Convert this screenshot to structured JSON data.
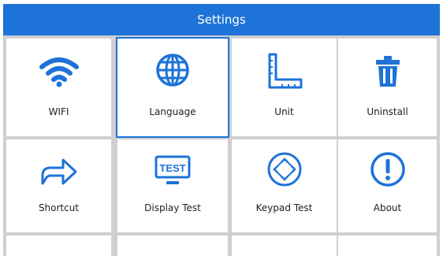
{
  "header": {
    "title": "Settings"
  },
  "colors": {
    "accent": "#1e73d8",
    "icon": "#1e73d8",
    "divider": "#cfcfcf"
  },
  "tiles": [
    {
      "label": "WIFI",
      "icon": "wifi-icon",
      "selected": false
    },
    {
      "label": "Language",
      "icon": "globe-icon",
      "selected": true
    },
    {
      "label": "Unit",
      "icon": "ruler-icon",
      "selected": false
    },
    {
      "label": "Uninstall",
      "icon": "trash-icon",
      "selected": false
    },
    {
      "label": "Shortcut",
      "icon": "share-arrow-icon",
      "selected": false
    },
    {
      "label": "Display Test",
      "icon": "display-test-icon",
      "selected": false,
      "icon_text": "TEST"
    },
    {
      "label": "Keypad Test",
      "icon": "keypad-icon",
      "selected": false
    },
    {
      "label": "About",
      "icon": "info-icon",
      "selected": false
    }
  ]
}
